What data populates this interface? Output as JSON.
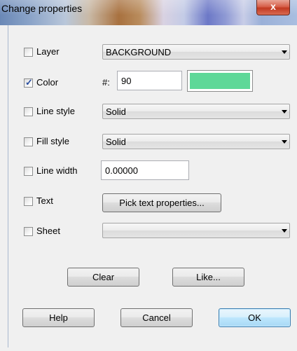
{
  "window": {
    "title": "Change properties",
    "close_glyph": "x"
  },
  "fields": {
    "layer": {
      "label": "Layer",
      "checked": false,
      "value": "BACKGROUND"
    },
    "color": {
      "label": "Color",
      "checked": true,
      "hash_label": "#:",
      "value": "90",
      "swatch": "#5ed898"
    },
    "line_style": {
      "label": "Line style",
      "checked": false,
      "value": "Solid"
    },
    "fill_style": {
      "label": "Fill style",
      "checked": false,
      "value": "Solid"
    },
    "line_width": {
      "label": "Line width",
      "checked": false,
      "value": "0.00000"
    },
    "text": {
      "label": "Text",
      "checked": false,
      "button": "Pick text properties..."
    },
    "sheet": {
      "label": "Sheet",
      "checked": false,
      "value": ""
    }
  },
  "buttons": {
    "clear": "Clear",
    "like": "Like...",
    "help": "Help",
    "cancel": "Cancel",
    "ok": "OK"
  },
  "colors": {
    "checkmark": "#2a4ea0",
    "default_button_border": "#3c7fb1"
  }
}
